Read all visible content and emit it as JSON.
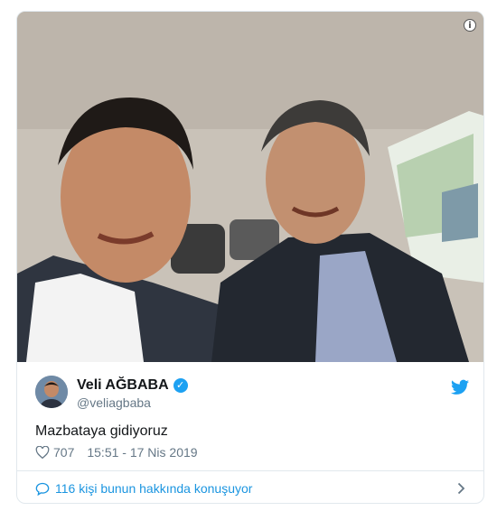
{
  "tweet": {
    "author": {
      "display_name": "Veli AĞBABA",
      "handle": "@veliagbaba",
      "verified": true
    },
    "text": "Mazbataya gidiyoruz",
    "likes": "707",
    "timestamp": "15:51 - 17 Nis 2019",
    "conversation_label": "116 kişi bunun hakkında konuşuyor"
  },
  "icons": {
    "info": "info-icon",
    "verified": "verified-badge-icon",
    "brand": "twitter-bird-icon",
    "like": "heart-icon",
    "conversation": "speech-bubble-icon",
    "expand": "chevron-right-icon"
  },
  "colors": {
    "accent": "#1da1f2",
    "link": "#1b95e0",
    "secondary_text": "#657786",
    "border": "#e1e8ed"
  }
}
